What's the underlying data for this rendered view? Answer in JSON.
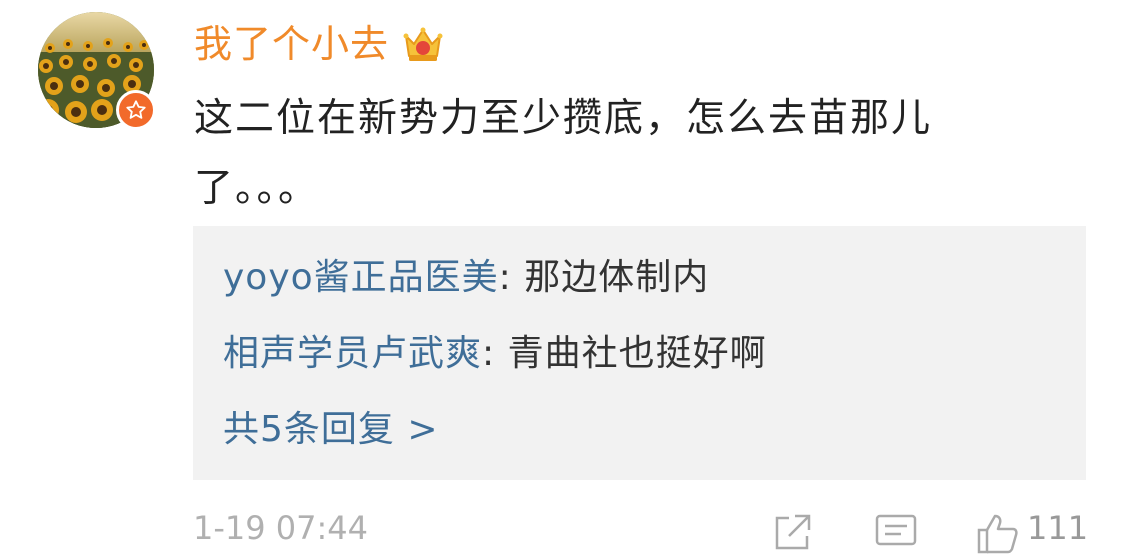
{
  "comment": {
    "username": "我了个小去",
    "text": "这二位在新势力至少攒底，怎么去苗那儿了。。。",
    "timestamp": "1-19 07:44",
    "like_count": "111"
  },
  "replies": [
    {
      "author": "yoyo酱正品医美",
      "separator": ": ",
      "text": "那边体制内"
    },
    {
      "author": "相声学员卢武爽",
      "separator": ": ",
      "text": "青曲社也挺好啊"
    }
  ],
  "more_replies_label": "共5条回复 >",
  "colors": {
    "username": "#f08a2a",
    "link": "#3f6e98",
    "reply_bg": "#f2f2f2",
    "badge": "#f26a2b"
  },
  "icons": {
    "avatar": "sunflower-field-photo",
    "badge": "verified-star-badge",
    "crown": "crown-icon",
    "share": "share-icon",
    "comment": "comment-icon",
    "like": "thumbs-up-icon"
  }
}
